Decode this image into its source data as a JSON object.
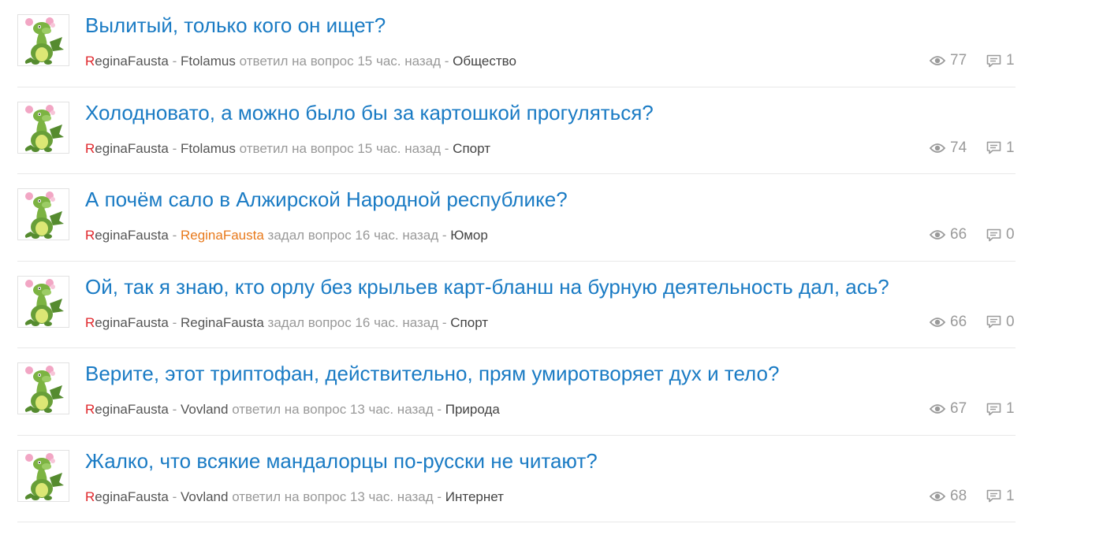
{
  "items": [
    {
      "title": "Вылитый, только кого он ищет?",
      "author_first": "R",
      "author_rest": "eginaFausta",
      "dash1": " - ",
      "user": "Ftolamus",
      "user_highlight": false,
      "action": " ответил на вопрос 15 час. назад ",
      "dash2": "- ",
      "category": "Общество",
      "views": "77",
      "comments": "1"
    },
    {
      "title": "Холодновато, а можно было бы за картошкой прогуляться?",
      "author_first": "R",
      "author_rest": "eginaFausta",
      "dash1": " - ",
      "user": "Ftolamus",
      "user_highlight": false,
      "action": " ответил на вопрос 15 час. назад ",
      "dash2": "- ",
      "category": "Спорт",
      "views": "74",
      "comments": "1"
    },
    {
      "title": "А почём сало в Алжирской Народной республике?",
      "author_first": "R",
      "author_rest": "eginaFausta",
      "dash1": " - ",
      "user": "ReginaFausta",
      "user_highlight": true,
      "action": " задал вопрос 16 час. назад ",
      "dash2": "- ",
      "category": "Юмор",
      "views": "66",
      "comments": "0"
    },
    {
      "title": "Ой, так я знаю, кто орлу без крыльев карт-бланш на бурную деятельность дал, ась?",
      "author_first": "R",
      "author_rest": "eginaFausta",
      "dash1": " - ",
      "user": "ReginaFausta",
      "user_highlight": false,
      "action": " задал вопрос 16 час. назад ",
      "dash2": "- ",
      "category": "Спорт",
      "views": "66",
      "comments": "0"
    },
    {
      "title": "Верите, этот триптофан, действительно, прям умиротворяет дух и тело?",
      "author_first": "R",
      "author_rest": "eginaFausta",
      "dash1": " - ",
      "user": "Vovland",
      "user_highlight": false,
      "action": " ответил на вопрос 13 час. назад ",
      "dash2": "- ",
      "category": "Природа",
      "views": "67",
      "comments": "1"
    },
    {
      "title": "Жалко, что всякие мандалорцы по-русски не читают?",
      "author_first": "R",
      "author_rest": "eginaFausta",
      "dash1": " - ",
      "user": "Vovland",
      "user_highlight": false,
      "action": " ответил на вопрос 13 час. назад ",
      "dash2": "- ",
      "category": "Интернет",
      "views": "68",
      "comments": "1"
    }
  ],
  "icons": {
    "views": "eye-icon",
    "comments": "comment-icon",
    "avatar": "dragon-avatar"
  },
  "colors": {
    "title": "#1a7bc4",
    "author_first_letter": "#e0262b",
    "highlight_user": "#e8791b",
    "muted": "#999999"
  }
}
